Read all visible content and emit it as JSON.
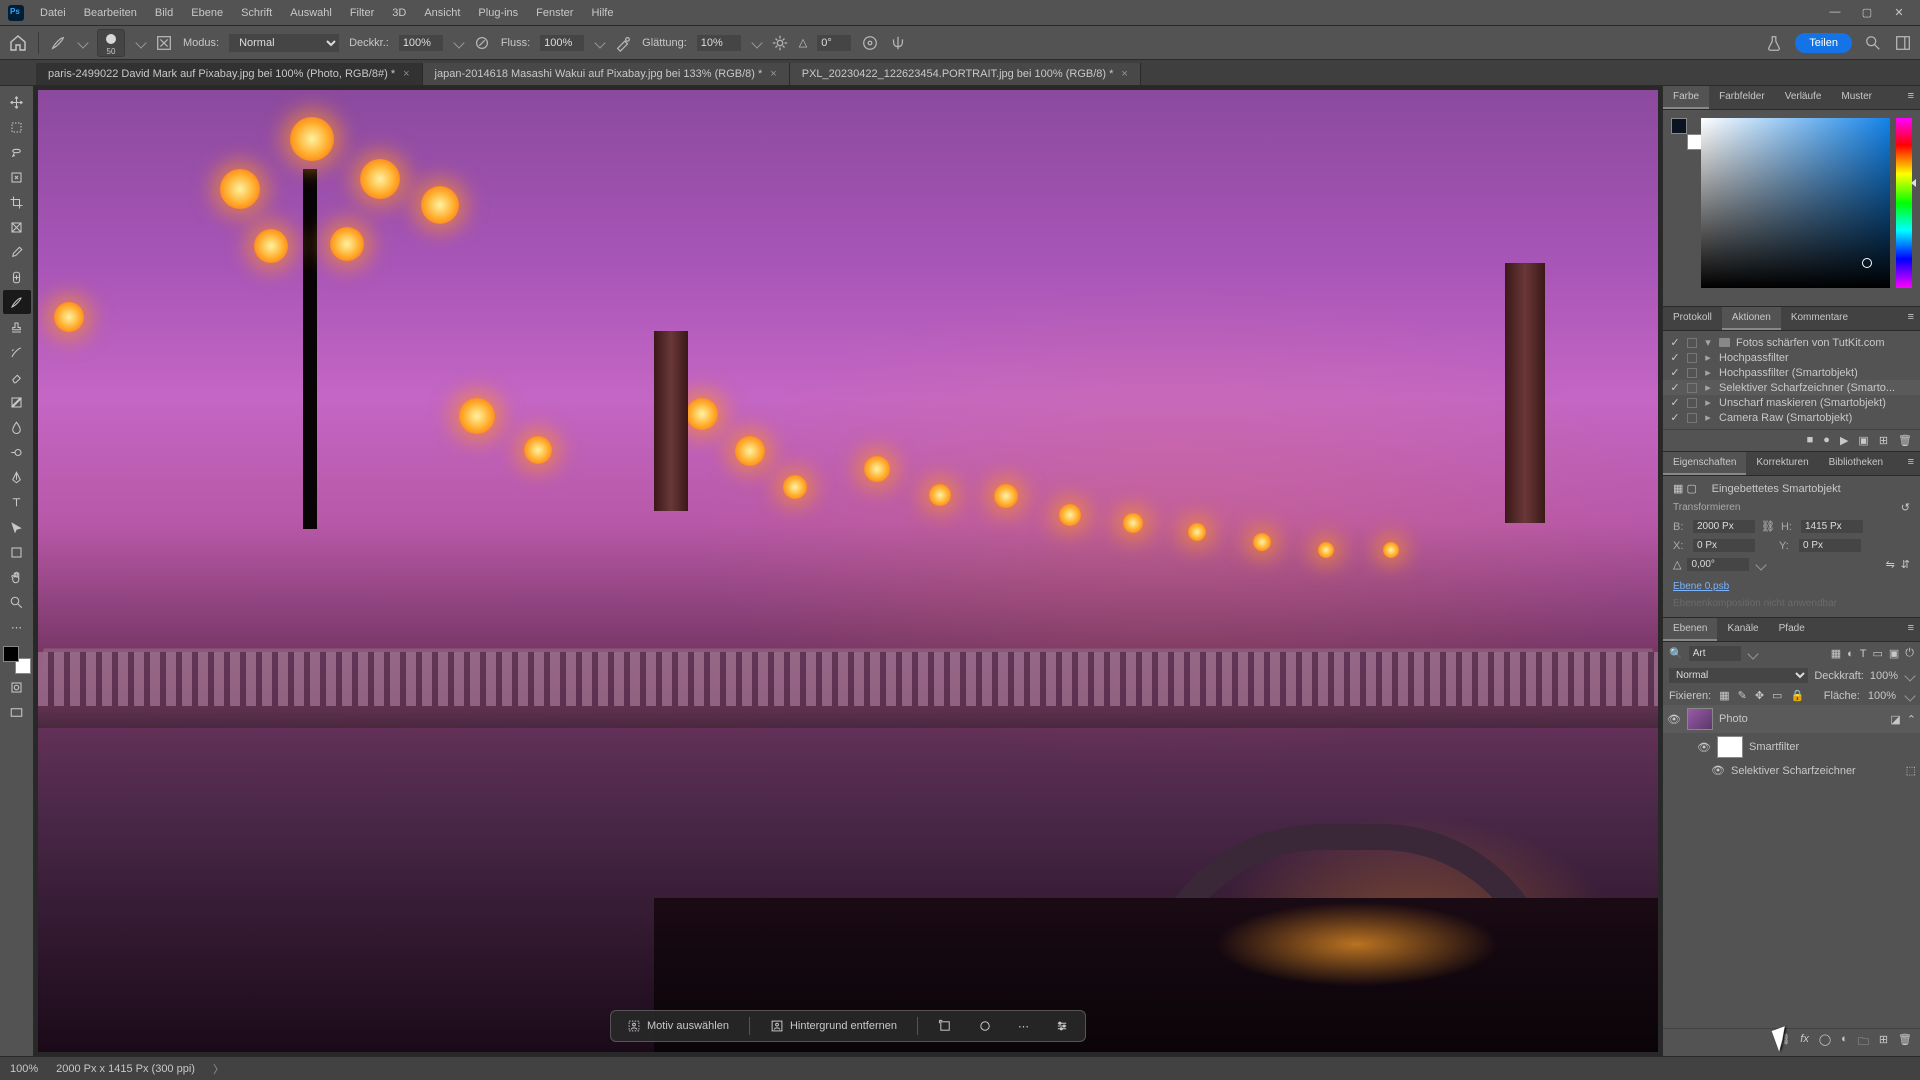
{
  "menu": {
    "items": [
      "Datei",
      "Bearbeiten",
      "Bild",
      "Ebene",
      "Schrift",
      "Auswahl",
      "Filter",
      "3D",
      "Ansicht",
      "Plug-ins",
      "Fenster",
      "Hilfe"
    ]
  },
  "optbar": {
    "brush_size": "50",
    "mode_label": "Modus:",
    "mode_value": "Normal",
    "opacity_label": "Deckkr.:",
    "opacity_value": "100%",
    "flow_label": "Fluss:",
    "flow_value": "100%",
    "smoothing_label": "Glättung:",
    "smoothing_value": "10%",
    "angle_icon": "△",
    "angle_value": "0°",
    "share": "Teilen"
  },
  "tabs": [
    {
      "label": "paris-2499022  David Mark auf Pixabay.jpg bei 100% (Photo, RGB/8#) *",
      "active": true
    },
    {
      "label": "japan-2014618 Masashi Wakui auf Pixabay.jpg bei 133% (RGB/8) *",
      "active": false
    },
    {
      "label": "PXL_20230422_122623454.PORTRAIT.jpg bei 100% (RGB/8) *",
      "active": false
    }
  ],
  "ctx": {
    "select_subject": "Motiv auswählen",
    "remove_bg": "Hintergrund entfernen"
  },
  "color_tabs": [
    "Farbe",
    "Farbfelder",
    "Verläufe",
    "Muster"
  ],
  "history_tabs": [
    "Protokoll",
    "Aktionen",
    "Kommentare"
  ],
  "actions_set_label": "Fotos schärfen von TutKit.com",
  "actions": [
    "Hochpassfilter",
    "Hochpassfilter (Smartobjekt)",
    "Selektiver Scharfzeichner (Smarto...",
    "Unscharf maskieren (Smartobjekt)",
    "Camera Raw (Smartobjekt)"
  ],
  "actions_selected_index": 2,
  "props_tabs": [
    "Eigenschaften",
    "Korrekturen",
    "Bibliotheken"
  ],
  "props": {
    "kind": "Eingebettetes Smartobjekt",
    "transform_label": "Transformieren",
    "w_label": "B:",
    "w": "2000 Px",
    "h_label": "H:",
    "h": "1415 Px",
    "x_label": "X:",
    "x": "0 Px",
    "y_label": "Y:",
    "y": "0 Px",
    "angle": "0,00°",
    "link": "Ebene 0.psb",
    "comp_label": "Ebenenkomposition nicht anwendbar"
  },
  "layer_tabs": [
    "Ebenen",
    "Kanäle",
    "Pfade"
  ],
  "layers": {
    "filter_kind": "Art",
    "blend": "Normal",
    "opacity_label": "Deckkraft:",
    "opacity": "100%",
    "lock_label": "Fixieren:",
    "fill_label": "Fläche:",
    "fill": "100%",
    "items": [
      {
        "name": "Photo",
        "selected": true
      },
      {
        "name": "Smartfilter",
        "sub": true
      },
      {
        "name": "Selektiver Scharfzeichner",
        "sub2": true
      }
    ]
  },
  "status": {
    "zoom": "100%",
    "dims": "2000 Px x 1415 Px (300 ppi)"
  }
}
